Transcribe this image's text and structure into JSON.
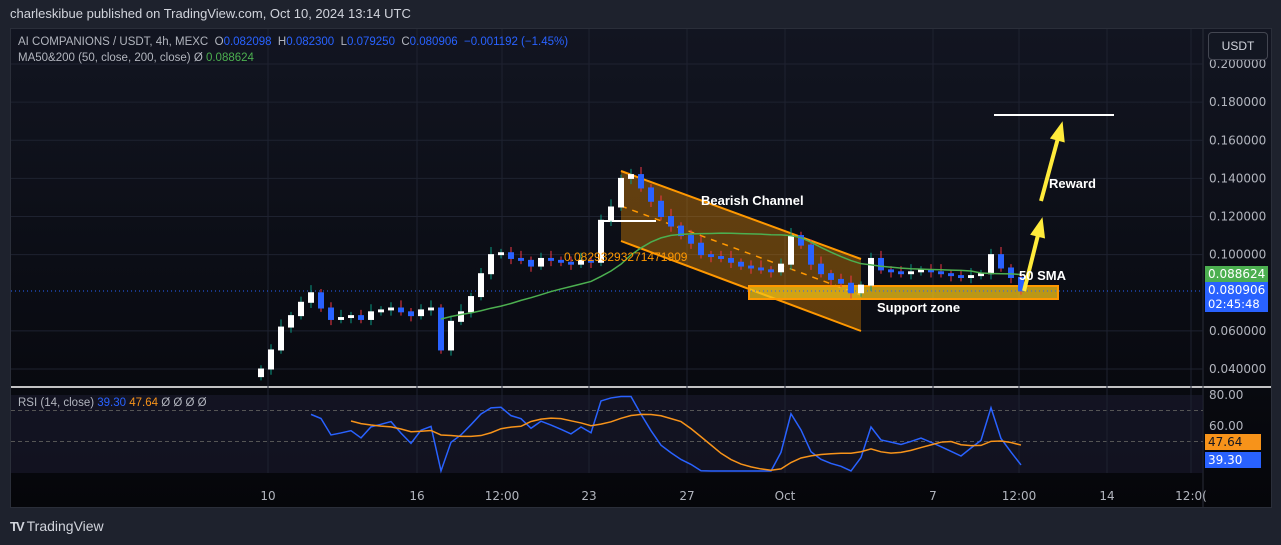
{
  "header": {
    "publisher_line": "charleskibue published on TradingView.com, Oct 10, 2024 13:14 UTC"
  },
  "legend": {
    "symbol": "AI COMPANIONS / USDT, 4h, MEXC",
    "o_label": "O",
    "o": "0.082098",
    "h_label": "H",
    "h": "0.082300",
    "l_label": "L",
    "l": "0.079250",
    "c_label": "C",
    "c": "0.080906",
    "change": "−0.001192 (−1.45%)",
    "ma_name": "MA50&200 (50, close, 200, close)",
    "ma_icon": "Ø",
    "ma_value": "0.088624",
    "rsi_name": "RSI (14, close)",
    "rsi_value": "39.30",
    "rsi_ma_value": "47.64",
    "rsi_icons": "Ø Ø Ø Ø"
  },
  "currency_button": "USDT",
  "price_tags": {
    "ma": "0.088624",
    "last": "0.080906",
    "countdown": "02:45:48",
    "rsi_ma": "47.64",
    "rsi": "39.30"
  },
  "annotations": {
    "channel": "Bearish Channel",
    "reward": "Reward",
    "sma": "50 SMA",
    "support": "Support zone",
    "level": "0.08293293271471909"
  },
  "footer": {
    "brand": "TradingView"
  },
  "colors": {
    "up": "#ffffff",
    "down": "#2962ff",
    "wick_up": "#089981",
    "wick_down": "#f23645",
    "ma": "#4caf50",
    "rsi": "#2962ff",
    "rsi_ma": "#f7931a",
    "channel": "#ff9800",
    "support": "#f5c518",
    "arrow": "#ffeb3b"
  },
  "chart_data": {
    "type": "candlestick",
    "y_axis": {
      "ticks": [
        "0.200000",
        "0.180000",
        "0.160000",
        "0.140000",
        "0.120000",
        "0.100000",
        "0.060000",
        "0.040000"
      ],
      "range": [
        0.04,
        0.2
      ]
    },
    "rsi_axis": {
      "ticks": [
        "80.00",
        "60.00"
      ],
      "range": [
        30,
        80
      ]
    },
    "x_axis": {
      "ticks": [
        "10",
        "16",
        "12:00",
        "23",
        "27",
        "Oct",
        "7",
        "12:00",
        "14",
        "12:0("
      ]
    },
    "closes": [
      0.04,
      0.05,
      0.062,
      0.068,
      0.075,
      0.08,
      0.072,
      0.066,
      0.067,
      0.068,
      0.066,
      0.07,
      0.071,
      0.072,
      0.07,
      0.068,
      0.071,
      0.072,
      0.05,
      0.065,
      0.07,
      0.078,
      0.09,
      0.1,
      0.101,
      0.098,
      0.097,
      0.094,
      0.098,
      0.097,
      0.096,
      0.095,
      0.097,
      0.096,
      0.118,
      0.125,
      0.14,
      0.142,
      0.135,
      0.128,
      0.12,
      0.115,
      0.11,
      0.106,
      0.1,
      0.099,
      0.098,
      0.096,
      0.094,
      0.093,
      0.092,
      0.091,
      0.095,
      0.11,
      0.105,
      0.095,
      0.09,
      0.087,
      0.085,
      0.08,
      0.084,
      0.098,
      0.092,
      0.091,
      0.09,
      0.091,
      0.092,
      0.091,
      0.09,
      0.089,
      0.088,
      0.089,
      0.09,
      0.1,
      0.093,
      0.088,
      0.081
    ]
  }
}
